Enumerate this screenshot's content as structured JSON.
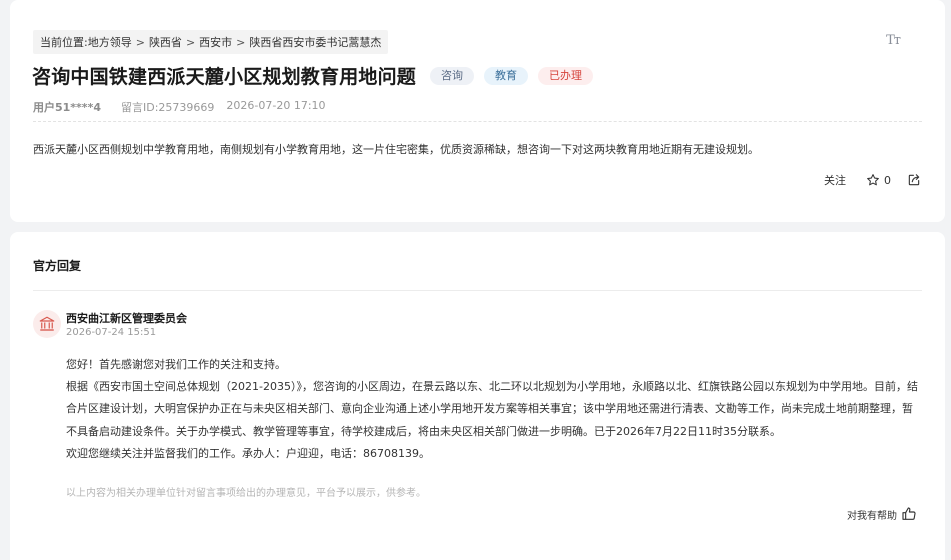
{
  "breadcrumb": {
    "prefix": "当前位置:",
    "items": [
      "地方领导",
      "陕西省",
      "西安市",
      "陕西省西安市委书记蒿慧杰"
    ],
    "separator": ">"
  },
  "font_size_toggle": "Tт",
  "message": {
    "title": "咨询中国铁建西派天麓小区规划教育用地问题",
    "tags": [
      "咨询",
      "教育",
      "已办理"
    ],
    "user": "用户51****4",
    "message_id": "留言ID:25739669",
    "datetime": "2026-07-20 17:10",
    "content": "西派天麓小区西侧规划中学教育用地，南侧规划有小学教育用地，这一片住宅密集，优质资源稀缺，想咨询一下对这两块教育用地近期有无建设规划。"
  },
  "actions": {
    "follow_label": "关注",
    "like_count": "0"
  },
  "reply": {
    "heading": "官方回复",
    "org_name": "西安曲江新区管理委员会",
    "date": "2026-07-24 15:51",
    "paragraphs": [
      "您好！首先感谢您对我们工作的关注和支持。",
      "根据《西安市国土空间总体规划（2021-2035）》，您咨询的小区周边，在景云路以东、北二环以北规划为小学用地，永顺路以北、红旗铁路公园以东规划为中学用地。目前，结合片区建设计划，大明宫保护办正在与未央区相关部门、意向企业沟通上述小学用地开发方案等相关事宜；该中学用地还需进行清表、文勘等工作，尚未完成土地前期整理，暂不具备启动建设条件。关于办学模式、教学管理等事宜，待学校建成后，将由未央区相关部门做进一步明确。已于2026年7月22日11时35分联系。",
      "欢迎您继续关注并监督我们的工作。承办人：户迎迎，电话：86708139。"
    ],
    "disclaimer": "以上内容为相关办理单位针对留言事项给出的办理意见，平台予以展示，供参考。",
    "helpful_label": "对我有帮助"
  },
  "colors": {
    "page_bg": "#f2f3f5",
    "card_bg": "#ffffff",
    "status_done": "#d6453d",
    "org_icon": "#d85a50"
  }
}
